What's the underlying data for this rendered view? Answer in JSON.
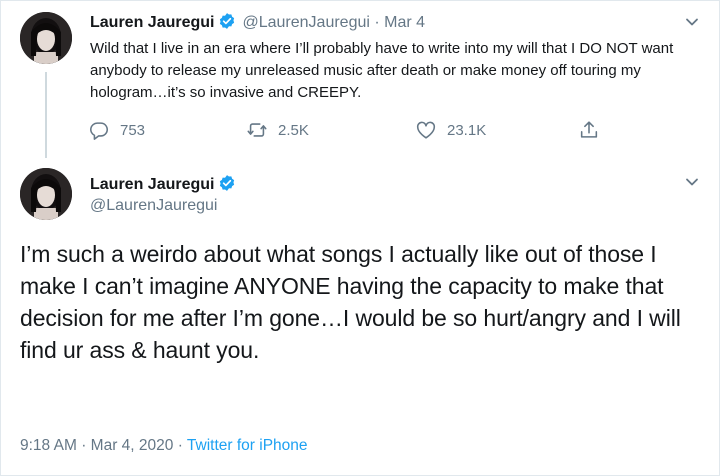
{
  "tweet1": {
    "name": "Lauren Jauregui",
    "handle": "@LaurenJauregui",
    "separator": "·",
    "date": "Mar 4",
    "text": "Wild that I live in an era where I’ll probably have to write into my will that I DO NOT want anybody to release my unreleased music after death or make money off touring my hologram…it’s so invasive and CREEPY.",
    "replies": "753",
    "retweets": "2.5K",
    "likes": "23.1K"
  },
  "tweet2": {
    "name": "Lauren Jauregui",
    "handle": "@LaurenJauregui",
    "text": "I’m such a weirdo about what songs I actually like out of those I make I can’t imagine ANYONE having the capacity to make that decision for me after I’m gone…I would be so hurt/angry and I will find ur ass & haunt you.",
    "time": "9:18 AM",
    "separator": "·",
    "date": "Mar 4, 2020",
    "separator2": "·",
    "source": "Twitter for iPhone"
  },
  "icons": {
    "verified": "verified-badge-icon",
    "chevron": "chevron-down-icon",
    "reply": "reply-icon",
    "retweet": "retweet-icon",
    "like": "heart-icon",
    "share": "share-icon"
  },
  "colors": {
    "verified": "#1da1f2",
    "muted": "#657786",
    "link": "#1da1f2"
  }
}
